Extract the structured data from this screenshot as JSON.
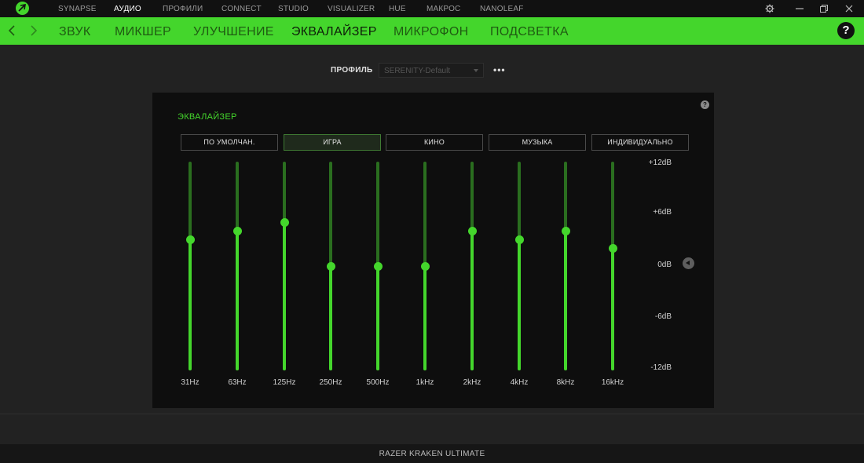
{
  "topnav": {
    "items": [
      {
        "label": "SYNAPSE"
      },
      {
        "label": "АУДИО"
      },
      {
        "label": "ПРОФИЛИ"
      },
      {
        "label": "CONNECT"
      },
      {
        "label": "STUDIO"
      },
      {
        "label": "VISUALIZER"
      },
      {
        "label": "HUE"
      },
      {
        "label": "МАКРОС"
      },
      {
        "label": "NANOLEAF"
      }
    ],
    "active_index": 1
  },
  "subnav": {
    "items": [
      {
        "label": "ЗВУК"
      },
      {
        "label": "МИКШЕР"
      },
      {
        "label": "УЛУЧШЕНИЕ"
      },
      {
        "label": "ЭКВАЛАЙЗЕР"
      },
      {
        "label": "МИКРОФОН"
      },
      {
        "label": "ПОДСВЕТКА"
      }
    ],
    "active_index": 3,
    "help_label": "?"
  },
  "profile": {
    "label": "ПРОФИЛЬ",
    "value": "SERENITY-Default",
    "more": "•••"
  },
  "equalizer": {
    "title": "ЭКВАЛАЙЗЕР",
    "help": "?",
    "presets": [
      {
        "label": "ПО УМОЛЧАН."
      },
      {
        "label": "ИГРА"
      },
      {
        "label": "КИНО"
      },
      {
        "label": "МУЗЫКА"
      },
      {
        "label": "ИНДИВИДУАЛЬНО"
      }
    ],
    "active_preset": 1,
    "db_scale": [
      {
        "label": "+12dB",
        "value": 12
      },
      {
        "label": "+6dB",
        "value": 6
      },
      {
        "label": "0dB",
        "value": 0
      },
      {
        "label": "-6dB",
        "value": -6
      },
      {
        "label": "-12dB",
        "value": -12
      }
    ],
    "bands": [
      {
        "freq": "31Hz",
        "gain_db": 3
      },
      {
        "freq": "63Hz",
        "gain_db": 4
      },
      {
        "freq": "125Hz",
        "gain_db": 5
      },
      {
        "freq": "250Hz",
        "gain_db": 0
      },
      {
        "freq": "500Hz",
        "gain_db": 0
      },
      {
        "freq": "1kHz",
        "gain_db": 0
      },
      {
        "freq": "2kHz",
        "gain_db": 4
      },
      {
        "freq": "4kHz",
        "gain_db": 3
      },
      {
        "freq": "8kHz",
        "gain_db": 4
      },
      {
        "freq": "16kHz",
        "gain_db": 2
      }
    ]
  },
  "device": {
    "name": "RAZER KRAKEN ULTIMATE"
  },
  "colors": {
    "accent": "#44d62c",
    "accent_dark": "#2a6e1f",
    "background": "#222222",
    "panel": "#0e0e0e"
  }
}
